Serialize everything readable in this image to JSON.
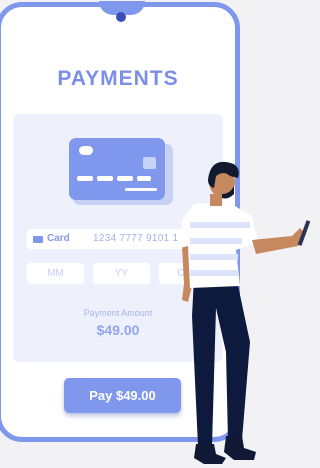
{
  "title": "PAYMENTS",
  "card_field": {
    "label": "Card",
    "number": "1234 7777 9101 1"
  },
  "expiry": {
    "month_placeholder": "MM",
    "year_placeholder": "YY",
    "cvv_placeholder": "CVV"
  },
  "amount": {
    "label": "Payment Amount",
    "value": "$49.00"
  },
  "pay_button": {
    "label": "Pay $49.00"
  },
  "colors": {
    "accent": "#7f98ee",
    "panel": "#eef1fb",
    "background": "#f2f2f4"
  }
}
